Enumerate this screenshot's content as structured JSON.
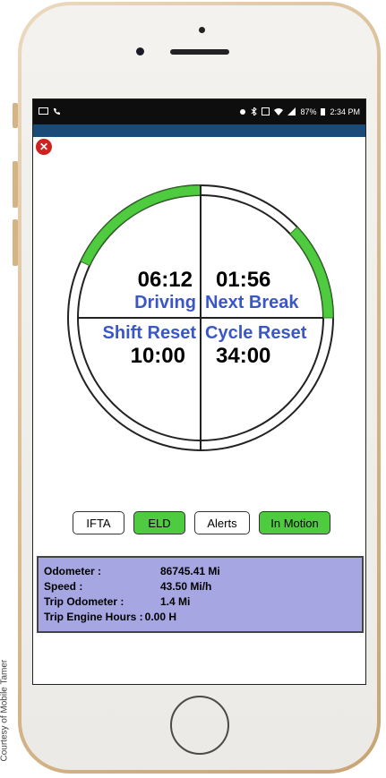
{
  "watermark": "Courtesy of Mobile Tamer",
  "status_bar": {
    "left_icons": [
      "tablet-icon",
      "phone-icon"
    ],
    "right_icons": [
      "alarm-icon",
      "bluetooth-icon",
      "nfc-icon",
      "wifi-icon",
      "signal-icon"
    ],
    "battery": "87%",
    "time": "2:34 PM"
  },
  "timers": {
    "driving": {
      "value": "06:12",
      "label": "Driving",
      "progress": 0.18
    },
    "next_break": {
      "value": "01:56",
      "label": "Next Break",
      "progress": 0.12
    },
    "shift_reset": {
      "value": "10:00",
      "label": "Shift Reset"
    },
    "cycle_reset": {
      "value": "34:00",
      "label": "Cycle Reset"
    }
  },
  "buttons": [
    {
      "label": "IFTA",
      "active": false
    },
    {
      "label": "ELD",
      "active": true
    },
    {
      "label": "Alerts",
      "active": false
    },
    {
      "label": "In Motion",
      "active": true
    }
  ],
  "info": {
    "odometer": {
      "label": "Odometer :",
      "value": "86745.41 Mi"
    },
    "speed": {
      "label": "Speed :",
      "value": "43.50 Mi/h"
    },
    "trip_odometer": {
      "label": "Trip Odometer :",
      "value": "1.4 Mi"
    },
    "trip_engine_hours": {
      "label": "Trip Engine Hours :",
      "value": "0.00 H"
    }
  },
  "colors": {
    "accent_green": "#4fcb3f",
    "label_blue": "#3b57c6",
    "info_bg": "#a6a6e2",
    "app_bar": "#1a4a77"
  }
}
